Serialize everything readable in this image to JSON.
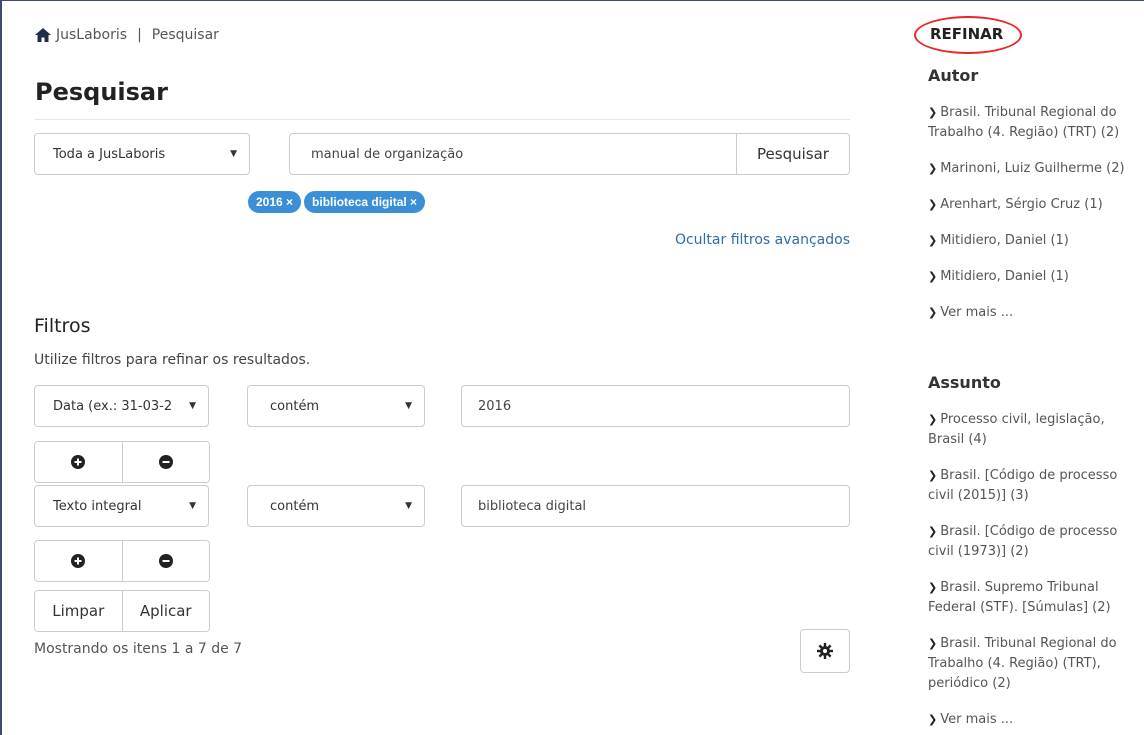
{
  "breadcrumb": {
    "home_label": "JusLaboris",
    "separator": "|",
    "current": "Pesquisar"
  },
  "page": {
    "title": "Pesquisar"
  },
  "search": {
    "scope_value": "Toda a JusLaboris",
    "query_value": "manual de organização",
    "button_label": "Pesquisar",
    "tags": [
      "2016 ×",
      "biblioteca digital ×"
    ],
    "toggle_filters_label": "Ocultar filtros avançados"
  },
  "filters": {
    "title": "Filtros",
    "description": "Utilize filtros para refinar os resultados.",
    "rows": [
      {
        "field": "Data (ex.: 31-03-2",
        "operator": "contém",
        "value": "2016"
      },
      {
        "field": "Texto integral",
        "operator": "contém",
        "value": "biblioteca digital"
      }
    ],
    "clear_label": "Limpar",
    "apply_label": "Aplicar"
  },
  "results": {
    "summary": "Mostrando os itens 1 a 7 de 7"
  },
  "sidebar": {
    "title": "REFINAR",
    "facets": [
      {
        "heading": "Autor",
        "items": [
          "Brasil. Tribunal Regional do Trabalho (4. Região) (TRT) (2)",
          "Marinoni, Luiz Guilherme (2)",
          "Arenhart, Sérgio Cruz (1)",
          "Mitidiero, Daniel (1)",
          "Mitidiero, Daniel (1)",
          "Ver mais ..."
        ]
      },
      {
        "heading": "Assunto",
        "items": [
          "Processo civil, legislação, Brasil (4)",
          "Brasil. [Código de processo civil (2015)] (3)",
          "Brasil. [Código de processo civil (1973)] (2)",
          "Brasil. Supremo Tribunal Federal (STF). [Súmulas] (2)",
          "Brasil. Tribunal Regional do Trabalho (4. Região) (TRT), periódico (2)",
          "Ver mais ..."
        ]
      }
    ]
  },
  "colors": {
    "accent": "#3a8fd6",
    "link": "#2a6fa8",
    "highlight_circle": "#e12a2a"
  },
  "icons": [
    "home-icon",
    "plus-circle-icon",
    "minus-circle-icon",
    "gear-icon",
    "chevron-right-circle-icon",
    "caret-down-icon"
  ]
}
